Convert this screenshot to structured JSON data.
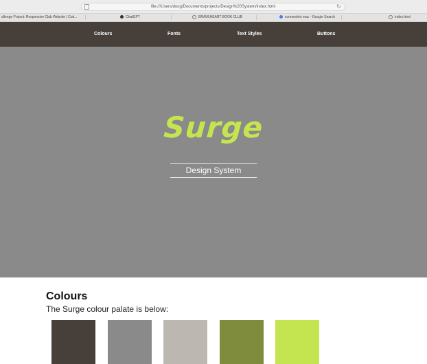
{
  "browser": {
    "url": "file:///Users/doug/Documents/projects/Design%20System/index.html",
    "tabs": [
      {
        "label": "allenge Project: Responsive Club Website | Cod...",
        "icon": "none"
      },
      {
        "label": "ChatGPT",
        "icon": "chatgpt-icon"
      },
      {
        "label": "BRAVEHEART BOOK CLUB",
        "icon": "globe-icon"
      },
      {
        "label": "screenshot mac - Google Search",
        "icon": "google-icon"
      },
      {
        "label": "index.html",
        "icon": "globe-icon"
      }
    ]
  },
  "nav": {
    "items": [
      "Colours",
      "Fonts",
      "Text Styles",
      "Buttons"
    ]
  },
  "hero": {
    "brand": "Surge",
    "subtitle": "Design System"
  },
  "colours": {
    "title": "Colours",
    "description": "The Surge colour palate is below:",
    "swatches": [
      "#463f3a",
      "#8a8a8a",
      "#bcb8b1",
      "#7f8c3d",
      "#c5e550"
    ]
  }
}
